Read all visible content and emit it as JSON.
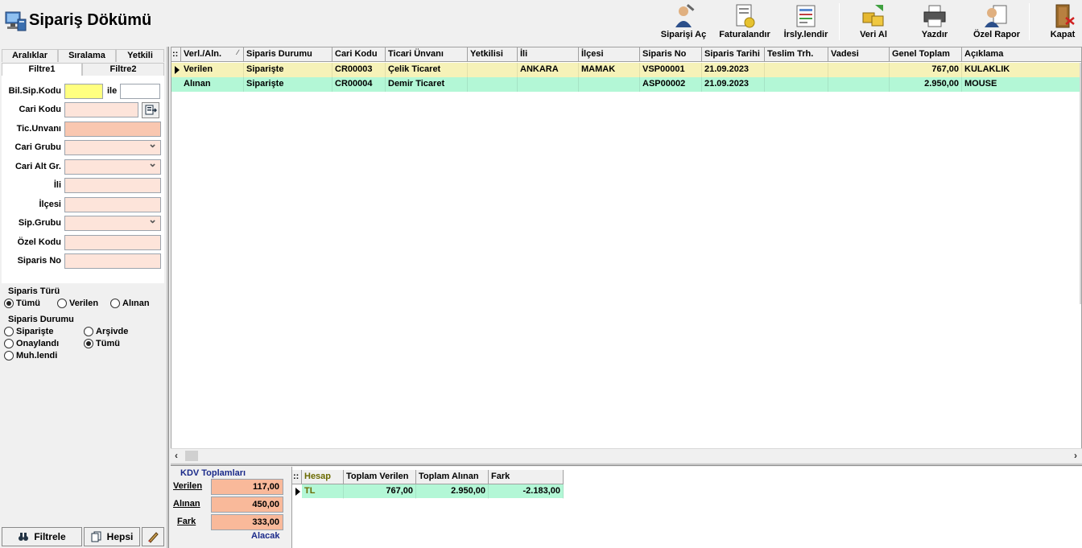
{
  "title": "Sipariş Dökümü",
  "toolbar": [
    {
      "label": "Siparişi Aç",
      "icon": "open-order-icon"
    },
    {
      "label": "Faturalandır",
      "icon": "invoice-icon"
    },
    {
      "label": "İrsly.lendir",
      "icon": "waybill-icon"
    },
    {
      "label": "Veri Al",
      "icon": "import-data-icon"
    },
    {
      "label": "Yazdır",
      "icon": "printer-icon"
    },
    {
      "label": "Özel Rapor",
      "icon": "custom-report-icon"
    },
    {
      "label": "Kapat",
      "icon": "exit-door-icon"
    }
  ],
  "left_tabs": {
    "row1": [
      "Aralıklar",
      "Sıralama",
      "Yetkili"
    ],
    "row2": [
      "Filtre1",
      "Filtre2"
    ],
    "active": "Filtre1"
  },
  "filters": {
    "bil_sip_kodu": "Bil.Sip.Kodu",
    "ile": "ile",
    "cari_kodu": "Cari Kodu",
    "tic_unvani": "Tic.Unvanı",
    "cari_grubu": "Cari Grubu",
    "cari_alt_gr": "Cari Alt Gr.",
    "ili": "İli",
    "ilcesi": "İlçesi",
    "sip_grubu": "Sip.Grubu",
    "ozel_kodu": "Özel Kodu",
    "siparis_no": "Siparis No"
  },
  "siparis_turu": {
    "title": "Siparis Türü",
    "options": [
      "Tümü",
      "Verilen",
      "Alınan"
    ],
    "selected": "Tümü"
  },
  "siparis_durumu": {
    "title": "Siparis Durumu",
    "options": [
      "Siparişte",
      "Arşivde",
      "Onaylandı",
      "Tümü",
      "Muh.lendi"
    ],
    "selected": "Tümü"
  },
  "buttons": {
    "filtrele": "Filtrele",
    "hepsi": "Hepsi"
  },
  "grid": {
    "columns": [
      "Verl./Aln.",
      "Siparis Durumu",
      "Cari Kodu",
      "Ticari Ünvanı",
      "Yetkilisi",
      "İli",
      "İlçesi",
      "Siparis No",
      "Siparis Tarihi",
      "Teslim Trh.",
      "Vadesi",
      "Genel Toplam",
      "Açıklama"
    ],
    "rows": [
      {
        "verl": "Verilen",
        "durum": "Siparişte",
        "cari_kodu": "CR00003",
        "unvan": "Çelik Ticaret",
        "yetkili": "",
        "ili": "ANKARA",
        "ilcesi": "MAMAK",
        "sip_no": "VSP00001",
        "tarih": "21.09.2023",
        "teslim": "",
        "vade": "",
        "toplam": "767,00",
        "aciklama": "KULAKLIK",
        "color": "#f6f2b8",
        "current": true
      },
      {
        "verl": "Alınan",
        "durum": "Siparişte",
        "cari_kodu": "CR00004",
        "unvan": "Demir Ticaret",
        "yetkili": "",
        "ili": "",
        "ilcesi": "",
        "sip_no": "ASP00002",
        "tarih": "21.09.2023",
        "teslim": "",
        "vade": "",
        "toplam": "2.950,00",
        "aciklama": "MOUSE",
        "color": "#b3f7d6",
        "current": false
      }
    ]
  },
  "kdv": {
    "title": "KDV Toplamları",
    "verilen_label": "Verilen",
    "verilen": "117,00",
    "alinan_label": "Alınan",
    "alinan": "450,00",
    "fark_label": "Fark",
    "fark": "333,00",
    "status": "Alacak"
  },
  "summary": {
    "columns": [
      "Hesap",
      "Toplam Verilen",
      "Toplam Alınan",
      "Fark"
    ],
    "rows": [
      {
        "hesap": "TL",
        "verilen": "767,00",
        "alinan": "2.950,00",
        "fark": "-2.183,00"
      }
    ]
  },
  "colors": {
    "accent_yellow": "#ffff80",
    "input_bg": "#fde4da",
    "kdv_bg": "#f9b99a",
    "row_verilen": "#f6f2b8",
    "row_alinan": "#b3f7d6"
  }
}
